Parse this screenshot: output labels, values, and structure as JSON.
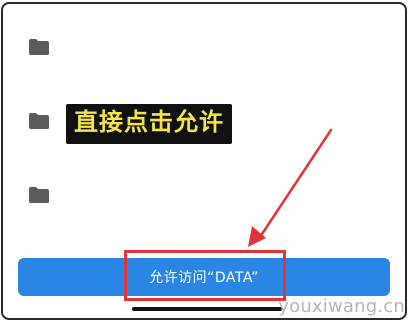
{
  "dialog": {
    "folders": [
      {
        "icon": "folder-icon"
      },
      {
        "icon": "folder-icon"
      },
      {
        "icon": "folder-icon"
      }
    ],
    "allow_button_label": "允许访问“DATA”"
  },
  "annotation": {
    "instruction_text": "直接点击允许",
    "instruction_text_color": "#f4e44a",
    "arrow_color": "#e0343a",
    "highlight_color": "#e0343a"
  },
  "colors": {
    "button_bg": "#2a86e4",
    "folder_icon": "#5b5b5b"
  },
  "watermark": {
    "text": "youxiwang.cn"
  }
}
